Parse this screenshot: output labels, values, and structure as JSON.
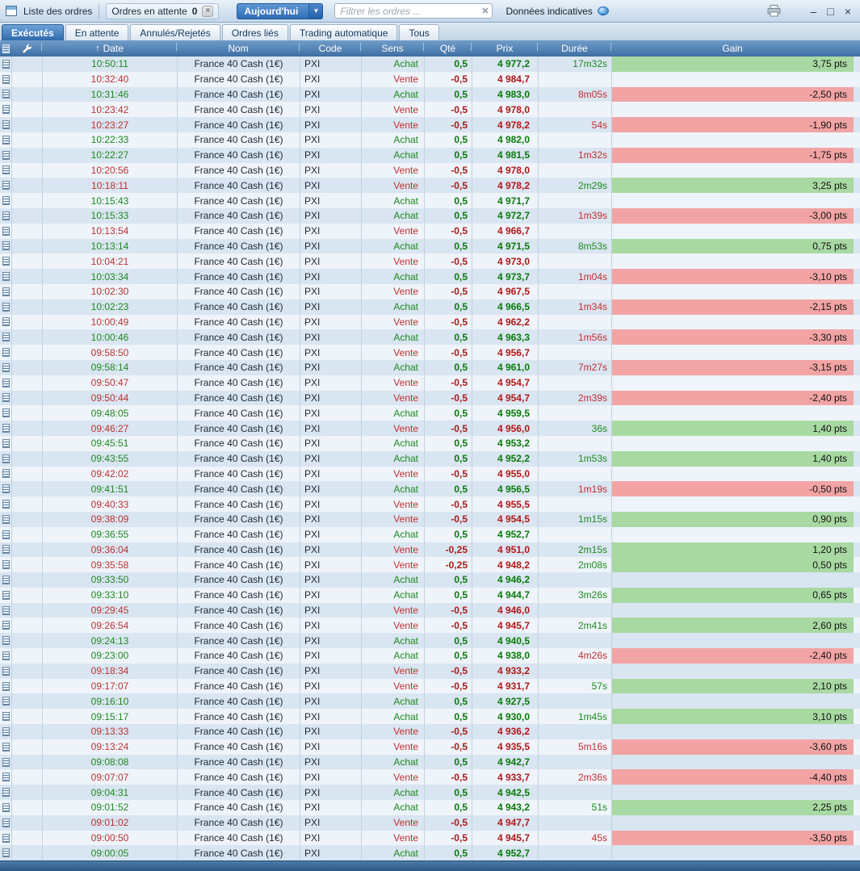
{
  "toolbar": {
    "title": "Liste des ordres",
    "pending_label": "Ordres en attente",
    "pending_count": "0",
    "period_select": "Aujourd'hui",
    "filter_placeholder": "Filtrer les ordres ...",
    "indicative_label": "Données indicatives"
  },
  "icons": {
    "sort_arrow": "↑",
    "dropdown_arrow": "▼",
    "clear_x": "✕",
    "pending_close_x": "×",
    "minimize": "–",
    "maximize": "□",
    "close": "×"
  },
  "colors": {
    "header_blue": "#3f6fa3",
    "active_tab_blue": "#2d6aad",
    "achat_green": "#1e8a1e",
    "vente_red": "#c03030",
    "gain_positive_bg": "#a8d9a2",
    "gain_negative_bg": "#f2a4a4",
    "row_alt_bg": "#d9e5f1",
    "row_bg": "#eef4fa"
  },
  "tabs": [
    {
      "label": "Exécutés",
      "slug": "executes",
      "active": true
    },
    {
      "label": "En attente",
      "slug": "en-attente",
      "active": false
    },
    {
      "label": "Annulés/Rejetés",
      "slug": "annules-rejetes",
      "active": false
    },
    {
      "label": "Ordres liés",
      "slug": "ordres-lies",
      "active": false
    },
    {
      "label": "Trading automatique",
      "slug": "trading-automatique",
      "active": false
    },
    {
      "label": "Tous",
      "slug": "tous",
      "active": false
    }
  ],
  "table": {
    "columns": [
      "Date",
      "Nom",
      "Code",
      "Sens",
      "Qté",
      "Prix",
      "Durée",
      "Gain"
    ],
    "rows": [
      {
        "date": "10:50:11",
        "nom": "France 40 Cash (1€)",
        "code": "PXI",
        "sens": "Achat",
        "qte": "0,5",
        "prix": "4 977,2",
        "duree": "17m32s",
        "gain": "3,75 pts",
        "sign": "pos"
      },
      {
        "date": "10:32:40",
        "nom": "France 40 Cash (1€)",
        "code": "PXI",
        "sens": "Vente",
        "qte": "-0,5",
        "prix": "4 984,7",
        "duree": "",
        "gain": "",
        "sign": ""
      },
      {
        "date": "10:31:46",
        "nom": "France 40 Cash (1€)",
        "code": "PXI",
        "sens": "Achat",
        "qte": "0,5",
        "prix": "4 983,0",
        "duree": "8m05s",
        "gain": "-2,50 pts",
        "sign": "neg"
      },
      {
        "date": "10:23:42",
        "nom": "France 40 Cash (1€)",
        "code": "PXI",
        "sens": "Vente",
        "qte": "-0,5",
        "prix": "4 978,0",
        "duree": "",
        "gain": "",
        "sign": ""
      },
      {
        "date": "10:23:27",
        "nom": "France 40 Cash (1€)",
        "code": "PXI",
        "sens": "Vente",
        "qte": "-0,5",
        "prix": "4 978,2",
        "duree": "54s",
        "gain": "-1,90 pts",
        "sign": "neg"
      },
      {
        "date": "10:22:33",
        "nom": "France 40 Cash (1€)",
        "code": "PXI",
        "sens": "Achat",
        "qte": "0,5",
        "prix": "4 982,0",
        "duree": "",
        "gain": "",
        "sign": ""
      },
      {
        "date": "10:22:27",
        "nom": "France 40 Cash (1€)",
        "code": "PXI",
        "sens": "Achat",
        "qte": "0,5",
        "prix": "4 981,5",
        "duree": "1m32s",
        "gain": "-1,75 pts",
        "sign": "neg"
      },
      {
        "date": "10:20:56",
        "nom": "France 40 Cash (1€)",
        "code": "PXI",
        "sens": "Vente",
        "qte": "-0,5",
        "prix": "4 978,0",
        "duree": "",
        "gain": "",
        "sign": ""
      },
      {
        "date": "10:18:11",
        "nom": "France 40 Cash (1€)",
        "code": "PXI",
        "sens": "Vente",
        "qte": "-0,5",
        "prix": "4 978,2",
        "duree": "2m29s",
        "gain": "3,25 pts",
        "sign": "pos"
      },
      {
        "date": "10:15:43",
        "nom": "France 40 Cash (1€)",
        "code": "PXI",
        "sens": "Achat",
        "qte": "0,5",
        "prix": "4 971,7",
        "duree": "",
        "gain": "",
        "sign": ""
      },
      {
        "date": "10:15:33",
        "nom": "France 40 Cash (1€)",
        "code": "PXI",
        "sens": "Achat",
        "qte": "0,5",
        "prix": "4 972,7",
        "duree": "1m39s",
        "gain": "-3,00 pts",
        "sign": "neg"
      },
      {
        "date": "10:13:54",
        "nom": "France 40 Cash (1€)",
        "code": "PXI",
        "sens": "Vente",
        "qte": "-0,5",
        "prix": "4 966,7",
        "duree": "",
        "gain": "",
        "sign": ""
      },
      {
        "date": "10:13:14",
        "nom": "France 40 Cash (1€)",
        "code": "PXI",
        "sens": "Achat",
        "qte": "0,5",
        "prix": "4 971,5",
        "duree": "8m53s",
        "gain": "0,75 pts",
        "sign": "pos"
      },
      {
        "date": "10:04:21",
        "nom": "France 40 Cash (1€)",
        "code": "PXI",
        "sens": "Vente",
        "qte": "-0,5",
        "prix": "4 973,0",
        "duree": "",
        "gain": "",
        "sign": ""
      },
      {
        "date": "10:03:34",
        "nom": "France 40 Cash (1€)",
        "code": "PXI",
        "sens": "Achat",
        "qte": "0,5",
        "prix": "4 973,7",
        "duree": "1m04s",
        "gain": "-3,10 pts",
        "sign": "neg"
      },
      {
        "date": "10:02:30",
        "nom": "France 40 Cash (1€)",
        "code": "PXI",
        "sens": "Vente",
        "qte": "-0,5",
        "prix": "4 967,5",
        "duree": "",
        "gain": "",
        "sign": ""
      },
      {
        "date": "10:02:23",
        "nom": "France 40 Cash (1€)",
        "code": "PXI",
        "sens": "Achat",
        "qte": "0,5",
        "prix": "4 966,5",
        "duree": "1m34s",
        "gain": "-2,15 pts",
        "sign": "neg"
      },
      {
        "date": "10:00:49",
        "nom": "France 40 Cash (1€)",
        "code": "PXI",
        "sens": "Vente",
        "qte": "-0,5",
        "prix": "4 962,2",
        "duree": "",
        "gain": "",
        "sign": ""
      },
      {
        "date": "10:00:46",
        "nom": "France 40 Cash (1€)",
        "code": "PXI",
        "sens": "Achat",
        "qte": "0,5",
        "prix": "4 963,3",
        "duree": "1m56s",
        "gain": "-3,30 pts",
        "sign": "neg"
      },
      {
        "date": "09:58:50",
        "nom": "France 40 Cash (1€)",
        "code": "PXI",
        "sens": "Vente",
        "qte": "-0,5",
        "prix": "4 956,7",
        "duree": "",
        "gain": "",
        "sign": ""
      },
      {
        "date": "09:58:14",
        "nom": "France 40 Cash (1€)",
        "code": "PXI",
        "sens": "Achat",
        "qte": "0,5",
        "prix": "4 961,0",
        "duree": "7m27s",
        "gain": "-3,15 pts",
        "sign": "neg"
      },
      {
        "date": "09:50:47",
        "nom": "France 40 Cash (1€)",
        "code": "PXI",
        "sens": "Vente",
        "qte": "-0,5",
        "prix": "4 954,7",
        "duree": "",
        "gain": "",
        "sign": ""
      },
      {
        "date": "09:50:44",
        "nom": "France 40 Cash (1€)",
        "code": "PXI",
        "sens": "Vente",
        "qte": "-0,5",
        "prix": "4 954,7",
        "duree": "2m39s",
        "gain": "-2,40 pts",
        "sign": "neg"
      },
      {
        "date": "09:48:05",
        "nom": "France 40 Cash (1€)",
        "code": "PXI",
        "sens": "Achat",
        "qte": "0,5",
        "prix": "4 959,5",
        "duree": "",
        "gain": "",
        "sign": ""
      },
      {
        "date": "09:46:27",
        "nom": "France 40 Cash (1€)",
        "code": "PXI",
        "sens": "Vente",
        "qte": "-0,5",
        "prix": "4 956,0",
        "duree": "36s",
        "gain": "1,40 pts",
        "sign": "pos"
      },
      {
        "date": "09:45:51",
        "nom": "France 40 Cash (1€)",
        "code": "PXI",
        "sens": "Achat",
        "qte": "0,5",
        "prix": "4 953,2",
        "duree": "",
        "gain": "",
        "sign": ""
      },
      {
        "date": "09:43:55",
        "nom": "France 40 Cash (1€)",
        "code": "PXI",
        "sens": "Achat",
        "qte": "0,5",
        "prix": "4 952,2",
        "duree": "1m53s",
        "gain": "1,40 pts",
        "sign": "pos"
      },
      {
        "date": "09:42:02",
        "nom": "France 40 Cash (1€)",
        "code": "PXI",
        "sens": "Vente",
        "qte": "-0,5",
        "prix": "4 955,0",
        "duree": "",
        "gain": "",
        "sign": ""
      },
      {
        "date": "09:41:51",
        "nom": "France 40 Cash (1€)",
        "code": "PXI",
        "sens": "Achat",
        "qte": "0,5",
        "prix": "4 956,5",
        "duree": "1m19s",
        "gain": "-0,50 pts",
        "sign": "neg"
      },
      {
        "date": "09:40:33",
        "nom": "France 40 Cash (1€)",
        "code": "PXI",
        "sens": "Vente",
        "qte": "-0,5",
        "prix": "4 955,5",
        "duree": "",
        "gain": "",
        "sign": ""
      },
      {
        "date": "09:38:09",
        "nom": "France 40 Cash (1€)",
        "code": "PXI",
        "sens": "Vente",
        "qte": "-0,5",
        "prix": "4 954,5",
        "duree": "1m15s",
        "gain": "0,90 pts",
        "sign": "pos"
      },
      {
        "date": "09:36:55",
        "nom": "France 40 Cash (1€)",
        "code": "PXI",
        "sens": "Achat",
        "qte": "0,5",
        "prix": "4 952,7",
        "duree": "",
        "gain": "",
        "sign": ""
      },
      {
        "date": "09:36:04",
        "nom": "France 40 Cash (1€)",
        "code": "PXI",
        "sens": "Vente",
        "qte": "-0,25",
        "prix": "4 951,0",
        "duree": "2m15s",
        "gain": "1,20 pts",
        "sign": "pos"
      },
      {
        "date": "09:35:58",
        "nom": "France 40 Cash (1€)",
        "code": "PXI",
        "sens": "Vente",
        "qte": "-0,25",
        "prix": "4 948,2",
        "duree": "2m08s",
        "gain": "0,50 pts",
        "sign": "pos"
      },
      {
        "date": "09:33:50",
        "nom": "France 40 Cash (1€)",
        "code": "PXI",
        "sens": "Achat",
        "qte": "0,5",
        "prix": "4 946,2",
        "duree": "",
        "gain": "",
        "sign": ""
      },
      {
        "date": "09:33:10",
        "nom": "France 40 Cash (1€)",
        "code": "PXI",
        "sens": "Achat",
        "qte": "0,5",
        "prix": "4 944,7",
        "duree": "3m26s",
        "gain": "0,65 pts",
        "sign": "pos"
      },
      {
        "date": "09:29:45",
        "nom": "France 40 Cash (1€)",
        "code": "PXI",
        "sens": "Vente",
        "qte": "-0,5",
        "prix": "4 946,0",
        "duree": "",
        "gain": "",
        "sign": ""
      },
      {
        "date": "09:26:54",
        "nom": "France 40 Cash (1€)",
        "code": "PXI",
        "sens": "Vente",
        "qte": "-0,5",
        "prix": "4 945,7",
        "duree": "2m41s",
        "gain": "2,60 pts",
        "sign": "pos"
      },
      {
        "date": "09:24:13",
        "nom": "France 40 Cash (1€)",
        "code": "PXI",
        "sens": "Achat",
        "qte": "0,5",
        "prix": "4 940,5",
        "duree": "",
        "gain": "",
        "sign": ""
      },
      {
        "date": "09:23:00",
        "nom": "France 40 Cash (1€)",
        "code": "PXI",
        "sens": "Achat",
        "qte": "0,5",
        "prix": "4 938,0",
        "duree": "4m26s",
        "gain": "-2,40 pts",
        "sign": "neg"
      },
      {
        "date": "09:18:34",
        "nom": "France 40 Cash (1€)",
        "code": "PXI",
        "sens": "Vente",
        "qte": "-0,5",
        "prix": "4 933,2",
        "duree": "",
        "gain": "",
        "sign": ""
      },
      {
        "date": "09:17:07",
        "nom": "France 40 Cash (1€)",
        "code": "PXI",
        "sens": "Vente",
        "qte": "-0,5",
        "prix": "4 931,7",
        "duree": "57s",
        "gain": "2,10 pts",
        "sign": "pos"
      },
      {
        "date": "09:16:10",
        "nom": "France 40 Cash (1€)",
        "code": "PXI",
        "sens": "Achat",
        "qte": "0,5",
        "prix": "4 927,5",
        "duree": "",
        "gain": "",
        "sign": ""
      },
      {
        "date": "09:15:17",
        "nom": "France 40 Cash (1€)",
        "code": "PXI",
        "sens": "Achat",
        "qte": "0,5",
        "prix": "4 930,0",
        "duree": "1m45s",
        "gain": "3,10 pts",
        "sign": "pos"
      },
      {
        "date": "09:13:33",
        "nom": "France 40 Cash (1€)",
        "code": "PXI",
        "sens": "Vente",
        "qte": "-0,5",
        "prix": "4 936,2",
        "duree": "",
        "gain": "",
        "sign": ""
      },
      {
        "date": "09:13:24",
        "nom": "France 40 Cash (1€)",
        "code": "PXI",
        "sens": "Vente",
        "qte": "-0,5",
        "prix": "4 935,5",
        "duree": "5m16s",
        "gain": "-3,60 pts",
        "sign": "neg"
      },
      {
        "date": "09:08:08",
        "nom": "France 40 Cash (1€)",
        "code": "PXI",
        "sens": "Achat",
        "qte": "0,5",
        "prix": "4 942,7",
        "duree": "",
        "gain": "",
        "sign": ""
      },
      {
        "date": "09:07:07",
        "nom": "France 40 Cash (1€)",
        "code": "PXI",
        "sens": "Vente",
        "qte": "-0,5",
        "prix": "4 933,7",
        "duree": "2m36s",
        "gain": "-4,40 pts",
        "sign": "neg"
      },
      {
        "date": "09:04:31",
        "nom": "France 40 Cash (1€)",
        "code": "PXI",
        "sens": "Achat",
        "qte": "0,5",
        "prix": "4 942,5",
        "duree": "",
        "gain": "",
        "sign": ""
      },
      {
        "date": "09:01:52",
        "nom": "France 40 Cash (1€)",
        "code": "PXI",
        "sens": "Achat",
        "qte": "0,5",
        "prix": "4 943,2",
        "duree": "51s",
        "gain": "2,25 pts",
        "sign": "pos"
      },
      {
        "date": "09:01:02",
        "nom": "France 40 Cash (1€)",
        "code": "PXI",
        "sens": "Vente",
        "qte": "-0,5",
        "prix": "4 947,7",
        "duree": "",
        "gain": "",
        "sign": ""
      },
      {
        "date": "09:00:50",
        "nom": "France 40 Cash (1€)",
        "code": "PXI",
        "sens": "Vente",
        "qte": "-0,5",
        "prix": "4 945,7",
        "duree": "45s",
        "gain": "-3,50 pts",
        "sign": "neg"
      },
      {
        "date": "09:00:05",
        "nom": "France 40 Cash (1€)",
        "code": "PXI",
        "sens": "Achat",
        "qte": "0,5",
        "prix": "4 952,7",
        "duree": "",
        "gain": "",
        "sign": ""
      }
    ]
  }
}
